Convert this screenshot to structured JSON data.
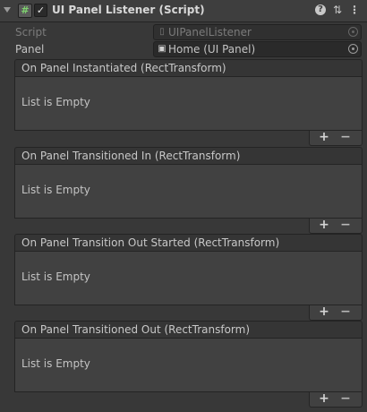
{
  "component": {
    "title": "UI Panel Listener (Script)",
    "enabled": true,
    "icons": [
      "foldout-arrow-icon",
      "script-icon",
      "help-icon",
      "preset-icon",
      "more-icon"
    ]
  },
  "properties": {
    "script_label": "Script",
    "script_value": "UIPanelListener",
    "panel_label": "Panel",
    "panel_value": "Home (UI Panel)"
  },
  "events": [
    {
      "title": "On Panel Instantiated (RectTransform)",
      "empty_text": "List is Empty"
    },
    {
      "title": "On Panel Transitioned In (RectTransform)",
      "empty_text": "List is Empty"
    },
    {
      "title": "On Panel Transition Out Started (RectTransform)",
      "empty_text": "List is Empty"
    },
    {
      "title": "On Panel Transitioned Out (RectTransform)",
      "empty_text": "List is Empty"
    }
  ],
  "list_controls": {
    "add": "+",
    "remove": "−"
  },
  "colors": {
    "background": "#383838",
    "header": "#3e3e3e",
    "field": "#2a2a2a",
    "list_body": "#414141"
  }
}
